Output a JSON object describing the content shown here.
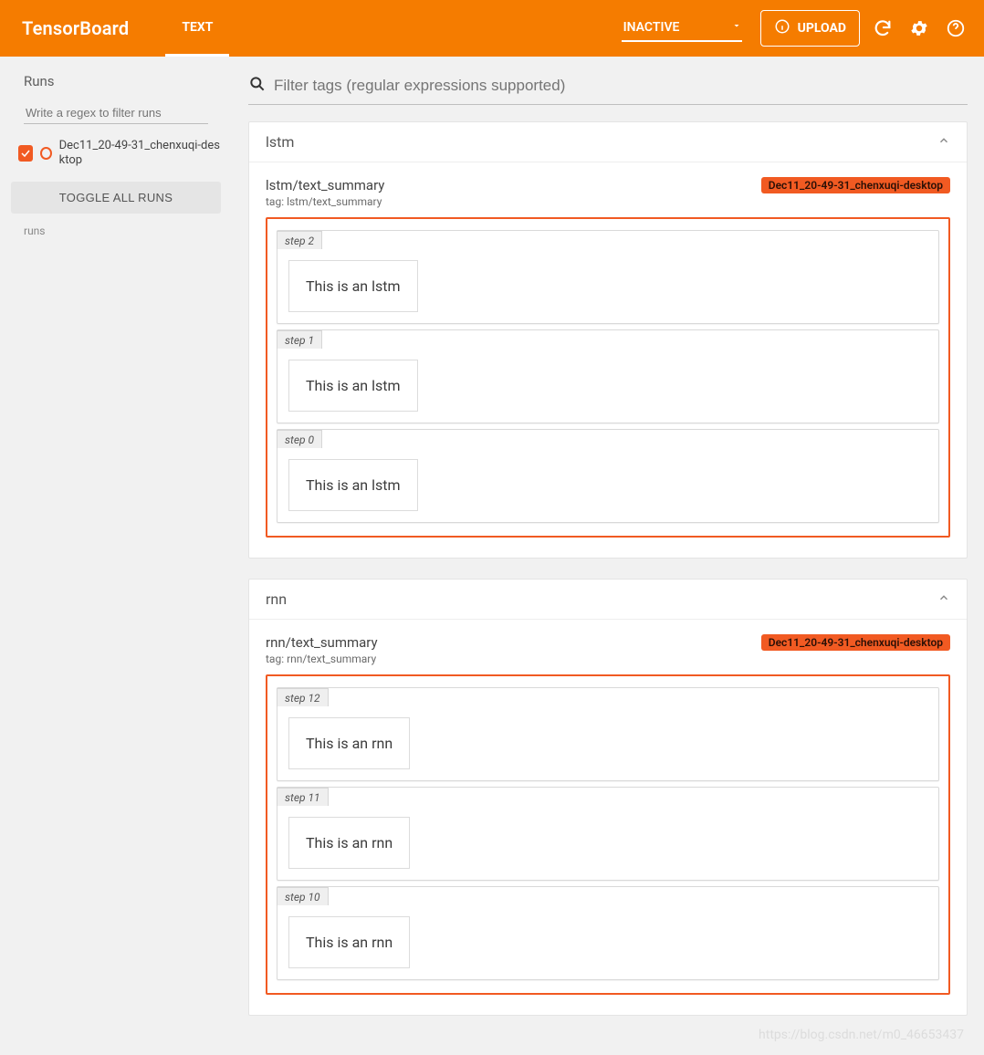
{
  "header": {
    "brand": "TensorBoard",
    "tab_text": "TEXT",
    "inactive": "INACTIVE",
    "upload": "UPLOAD"
  },
  "sidebar": {
    "title": "Runs",
    "filter_placeholder": "Write a regex to filter runs",
    "run_name": "Dec11_20-49-31_chenxuqi-desktop",
    "toggle": "TOGGLE ALL RUNS",
    "footer": "runs"
  },
  "main": {
    "filter_placeholder": "Filter tags (regular expressions supported)",
    "panels": [
      {
        "title": "lstm",
        "summary_title": "lstm/text_summary",
        "summary_tag": "tag: lstm/text_summary",
        "run_badge": "Dec11_20-49-31_chenxuqi-desktop",
        "steps": [
          {
            "label": "step 2",
            "text": "This is an lstm"
          },
          {
            "label": "step 1",
            "text": "This is an lstm"
          },
          {
            "label": "step 0",
            "text": "This is an lstm"
          }
        ]
      },
      {
        "title": "rnn",
        "summary_title": "rnn/text_summary",
        "summary_tag": "tag: rnn/text_summary",
        "run_badge": "Dec11_20-49-31_chenxuqi-desktop",
        "steps": [
          {
            "label": "step 12",
            "text": "This is an rnn"
          },
          {
            "label": "step 11",
            "text": "This is an rnn"
          },
          {
            "label": "step 10",
            "text": "This is an rnn"
          }
        ]
      }
    ]
  },
  "watermark": "https://blog.csdn.net/m0_46653437"
}
